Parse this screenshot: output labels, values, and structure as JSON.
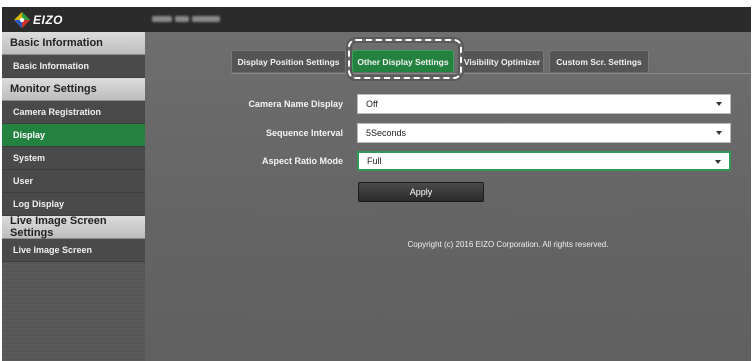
{
  "header": {
    "logo_text": "EIZO",
    "host_label_blurred": "",
    "colors": {
      "bar": "#2b2b2b",
      "accent_green": "#238240"
    }
  },
  "sidebar": {
    "sections": [
      {
        "title": "Basic Information",
        "items": [
          {
            "label": "Basic Information",
            "active": false
          }
        ]
      },
      {
        "title": "Monitor Settings",
        "items": [
          {
            "label": "Camera Registration",
            "active": false
          },
          {
            "label": "Display",
            "active": true
          },
          {
            "label": "System",
            "active": false
          },
          {
            "label": "User",
            "active": false
          },
          {
            "label": "Log Display",
            "active": false
          }
        ]
      },
      {
        "title": "Live Image Screen Settings",
        "items": [
          {
            "label": "Live Image Screen",
            "active": false
          }
        ]
      }
    ]
  },
  "tabs": [
    {
      "label": "Display Position Settings",
      "active": false
    },
    {
      "label": "Other Display Settings",
      "active": true
    },
    {
      "label": "Visibility Optimizer",
      "active": false
    },
    {
      "label": "Custom Scr. Settings",
      "active": false
    }
  ],
  "form": {
    "fields": [
      {
        "label": "Camera Name Display",
        "value": "Off"
      },
      {
        "label": "Sequence Interval",
        "value": "5Seconds"
      },
      {
        "label": "Aspect Ratio Mode",
        "value": "Full"
      }
    ],
    "apply_label": "Apply"
  },
  "footer": {
    "copyright": "Copyright (c) 2016 EIZO Corporation. All rights reserved."
  }
}
